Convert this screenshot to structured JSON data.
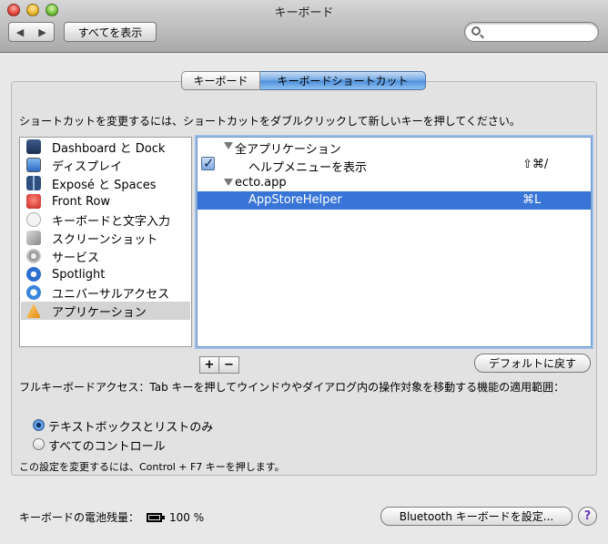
{
  "window": {
    "title": "キーボード"
  },
  "toolbar": {
    "show_all_label": "すべてを表示",
    "search_placeholder": ""
  },
  "tabs": [
    {
      "label": "キーボード",
      "active": false
    },
    {
      "label": "キーボードショートカット",
      "active": true
    }
  ],
  "instruction": "ショートカットを変更するには、ショートカットをダブルクリックして新しいキーを押してください。",
  "categories": [
    {
      "label": "Dashboard と Dock",
      "icon": "dashboard-icon",
      "selected": false
    },
    {
      "label": "ディスプレイ",
      "icon": "display-icon",
      "selected": false
    },
    {
      "label": "Exposé と Spaces",
      "icon": "spaces-icon",
      "selected": false
    },
    {
      "label": "Front Row",
      "icon": "front-row-icon",
      "selected": false
    },
    {
      "label": "キーボードと文字入力",
      "icon": "keyboard-icon",
      "selected": false
    },
    {
      "label": "スクリーンショット",
      "icon": "screenshot-icon",
      "selected": false
    },
    {
      "label": "サービス",
      "icon": "gear-icon",
      "selected": false
    },
    {
      "label": "Spotlight",
      "icon": "spotlight-icon",
      "selected": false
    },
    {
      "label": "ユニバーサルアクセス",
      "icon": "universal-access-icon",
      "selected": false
    },
    {
      "label": "アプリケーション",
      "icon": "applications-icon",
      "selected": true
    }
  ],
  "shortcuts": [
    {
      "type": "group",
      "label": "全アプリケーション"
    },
    {
      "type": "item",
      "checked": true,
      "label": "ヘルプメニューを表示",
      "key": "⇧⌘/"
    },
    {
      "type": "group",
      "label": "ecto.app"
    },
    {
      "type": "item",
      "selected": true,
      "label": "AppStoreHelper",
      "key": "⌘L"
    }
  ],
  "buttons": {
    "add": "+",
    "remove": "−",
    "restore_defaults": "デフォルトに戻す",
    "bluetooth": "Bluetooth キーボードを設定...",
    "help": "?"
  },
  "full_keyboard_access": {
    "description": "フルキーボードアクセス：Tab キーを押してウインドウやダイアログ内の操作対象を移動する機能の適用範囲：",
    "options": [
      {
        "label": "テキストボックスとリストのみ",
        "selected": true
      },
      {
        "label": "すべてのコントロール",
        "selected": false
      }
    ],
    "hint": "この設定を変更するには、Control + F7 キーを押します。"
  },
  "battery": {
    "label": "キーボードの電池残量：",
    "value": "100 %",
    "level": 1.0
  },
  "colors": {
    "selection": "#3875d7",
    "tab_active": "#4d8fdb"
  }
}
